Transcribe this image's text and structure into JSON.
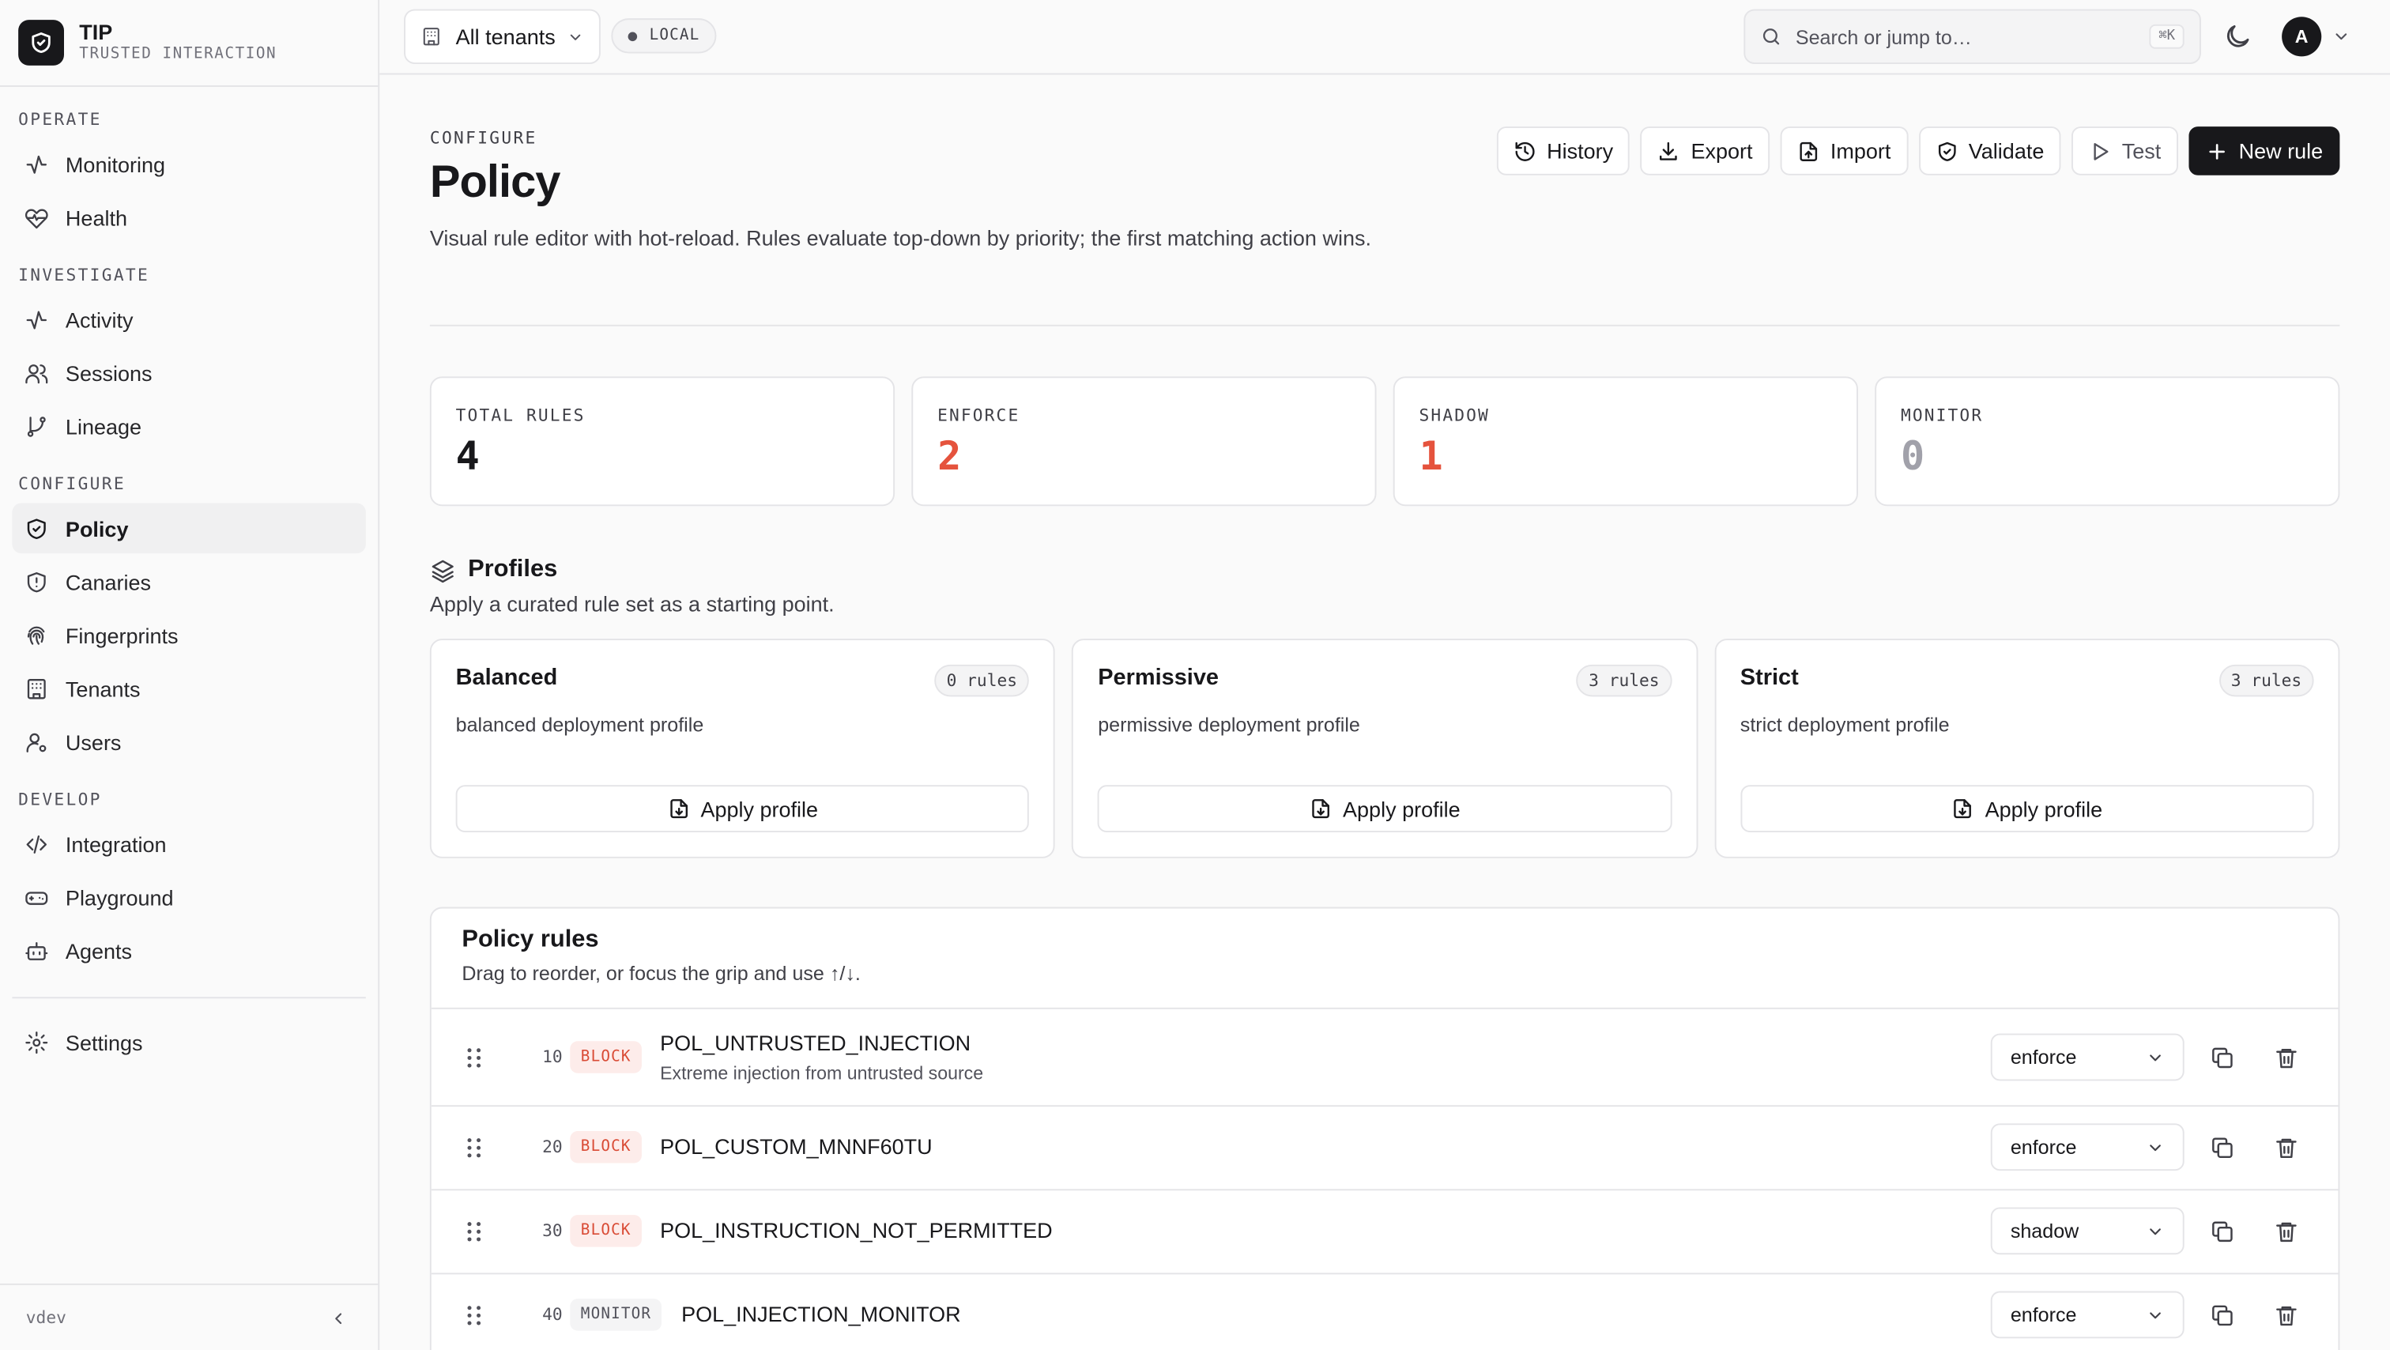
{
  "brand": {
    "name": "TIP",
    "subtitle": "TRUSTED INTERACTION"
  },
  "nav": {
    "sections": [
      {
        "title": "OPERATE",
        "items": [
          "Monitoring",
          "Health"
        ]
      },
      {
        "title": "INVESTIGATE",
        "items": [
          "Activity",
          "Sessions",
          "Lineage"
        ]
      },
      {
        "title": "CONFIGURE",
        "items": [
          "Policy",
          "Canaries",
          "Fingerprints",
          "Tenants",
          "Users"
        ]
      },
      {
        "title": "DEVELOP",
        "items": [
          "Integration",
          "Playground",
          "Agents"
        ]
      }
    ],
    "settings": "Settings",
    "active": "Policy",
    "version": "vdev"
  },
  "topbar": {
    "tenant": "All tenants",
    "env": "LOCAL",
    "search_placeholder": "Search or jump to…",
    "shortcut": "⌘K",
    "avatar": "A"
  },
  "header": {
    "eyebrow": "CONFIGURE",
    "title": "Policy",
    "description": "Visual rule editor with hot-reload. Rules evaluate top-down by priority; the first matching action wins.",
    "actions": {
      "history": "History",
      "export": "Export",
      "import": "Import",
      "validate": "Validate",
      "test": "Test",
      "new_rule": "New rule"
    }
  },
  "stats": [
    {
      "label": "TOTAL RULES",
      "value": "4"
    },
    {
      "label": "ENFORCE",
      "value": "2"
    },
    {
      "label": "SHADOW",
      "value": "1"
    },
    {
      "label": "MONITOR",
      "value": "0"
    }
  ],
  "profiles": {
    "title": "Profiles",
    "subtitle": "Apply a curated rule set as a starting point.",
    "apply_label": "Apply profile",
    "items": [
      {
        "name": "Balanced",
        "count": "0 rules",
        "description": "balanced deployment profile"
      },
      {
        "name": "Permissive",
        "count": "3 rules",
        "description": "permissive deployment profile"
      },
      {
        "name": "Strict",
        "count": "3 rules",
        "description": "strict deployment profile"
      }
    ]
  },
  "rules": {
    "title": "Policy rules",
    "subtitle": "Drag to reorder, or focus the grip and use ↑/↓.",
    "rows": [
      {
        "priority": "10",
        "action": "BLOCK",
        "name": "POL_UNTRUSTED_INJECTION",
        "description": "Extreme injection from untrusted source",
        "mode": "enforce"
      },
      {
        "priority": "20",
        "action": "BLOCK",
        "name": "POL_CUSTOM_MNNF60TU",
        "description": "",
        "mode": "enforce"
      },
      {
        "priority": "30",
        "action": "BLOCK",
        "name": "POL_INSTRUCTION_NOT_PERMITTED",
        "description": "",
        "mode": "shadow"
      },
      {
        "priority": "40",
        "action": "MONITOR",
        "name": "POL_INJECTION_MONITOR",
        "description": "",
        "mode": "enforce"
      }
    ]
  },
  "colors": {
    "accent": "#18181b",
    "danger": "#e5533d",
    "muted": "#a1a1aa"
  }
}
